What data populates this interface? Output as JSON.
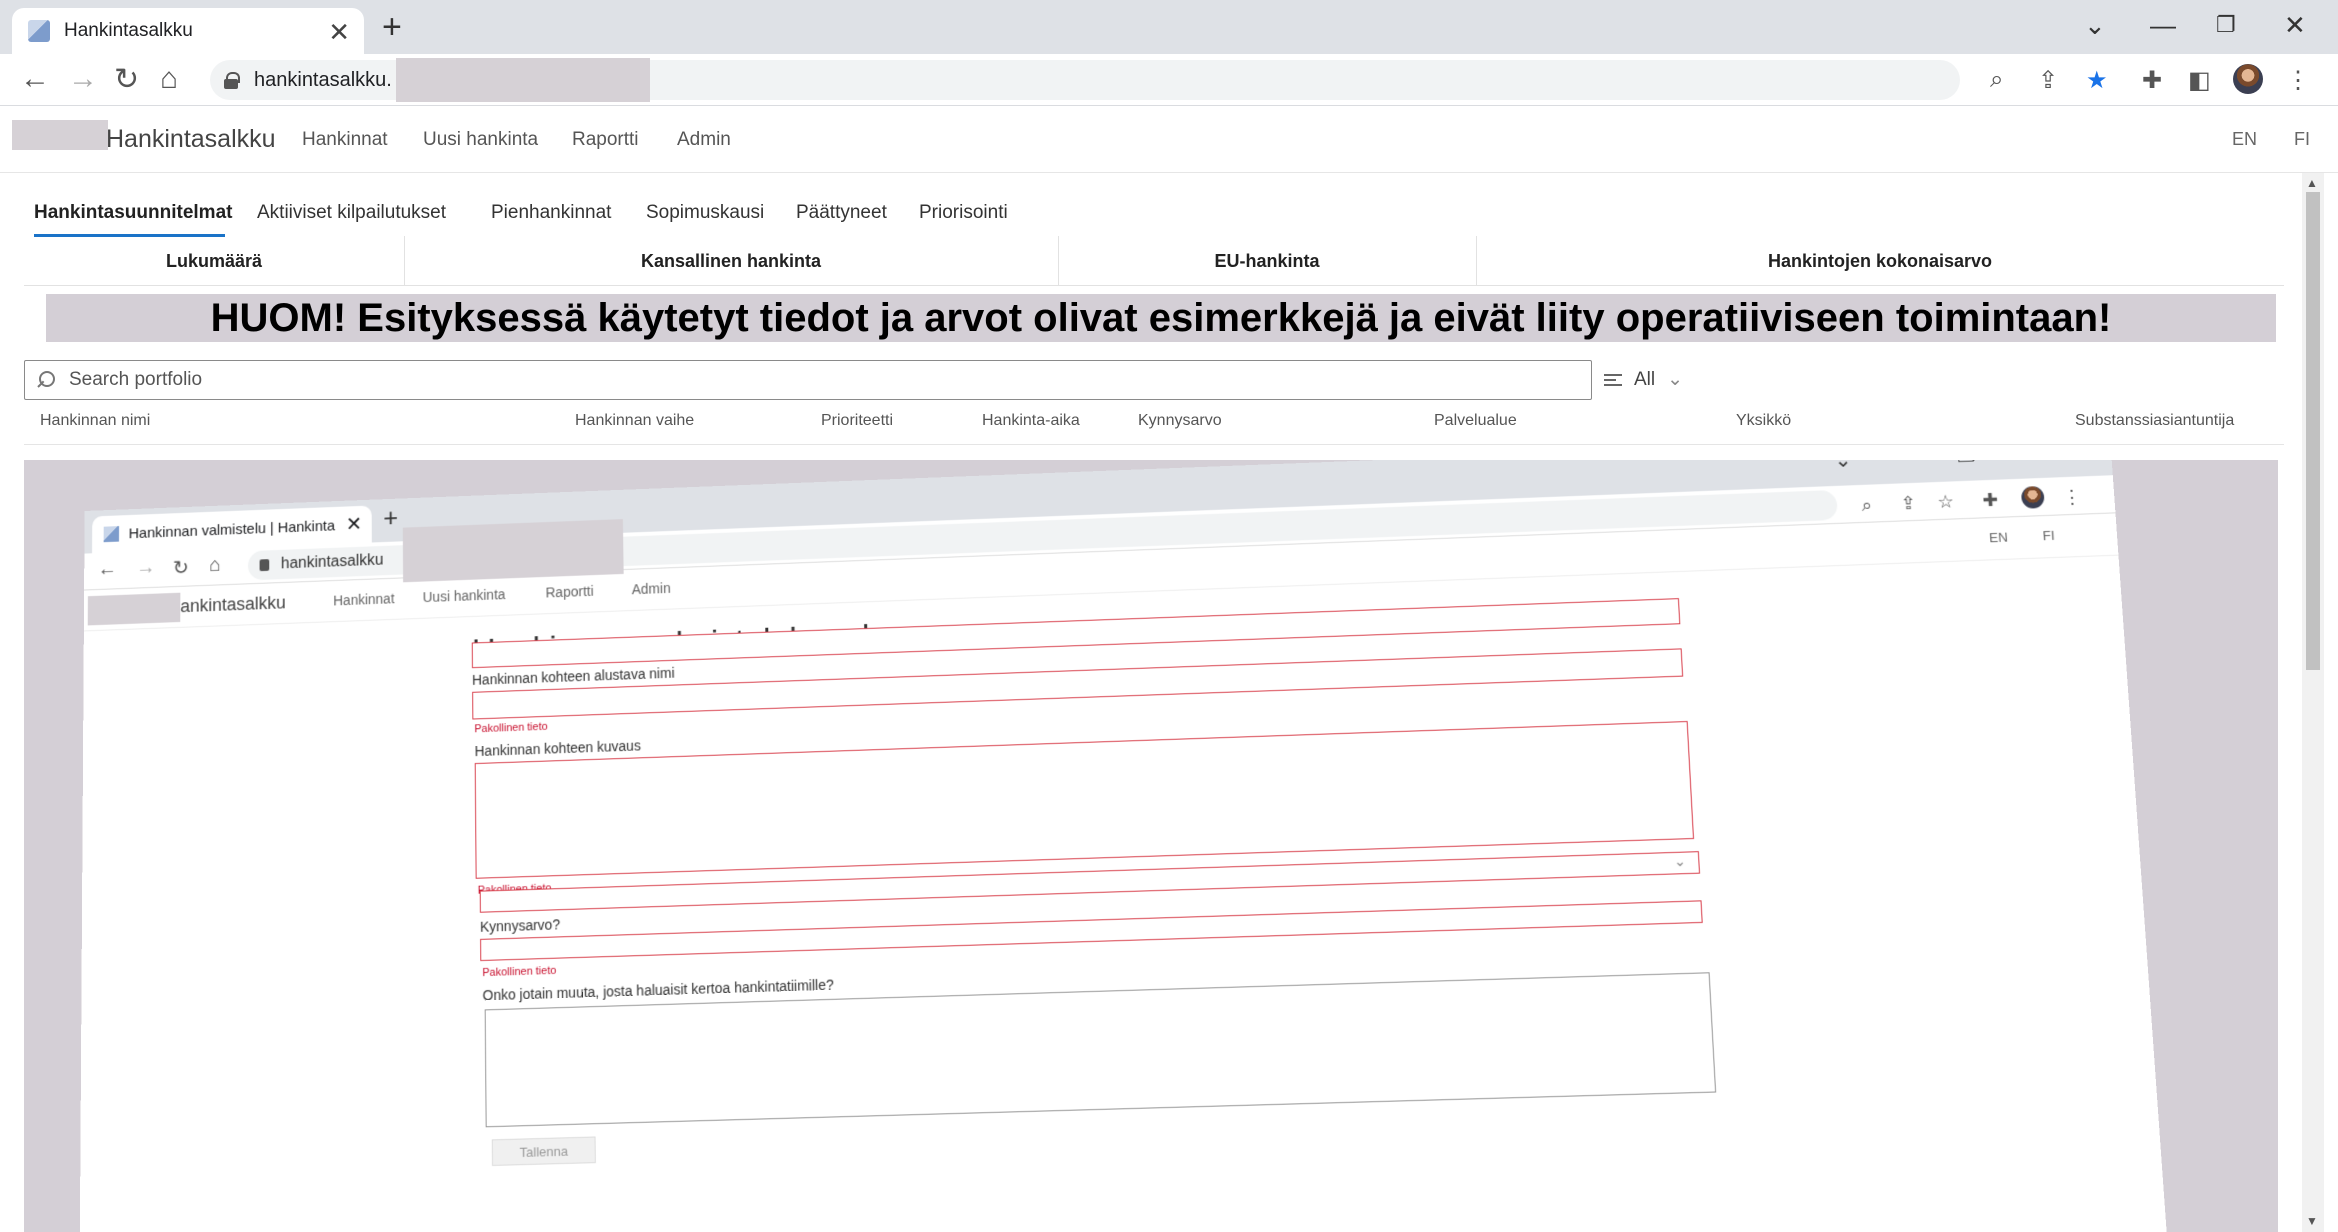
{
  "browser": {
    "tab_title": "Hankintasalkku",
    "tab_close": "✕",
    "new_tab": "+",
    "url_prefix": "hankintasalkku."
  },
  "app": {
    "brand": "Hankintasalkku",
    "nav": [
      "Hankinnat",
      "Uusi hankinta",
      "Raportti",
      "Admin"
    ],
    "lang": [
      "EN",
      "FI"
    ]
  },
  "portfolio_tabs": {
    "items": [
      "Hankintasuunnitelmat",
      "Aktiiviset kilpailutukset",
      "Pienhankinnat",
      "Sopimuskausi",
      "Päättyneet",
      "Priorisointi"
    ],
    "active": "Hankintasuunnitelmat"
  },
  "kpis": [
    "Lukumäärä",
    "Kansallinen hankinta",
    "EU-hankinta",
    "Hankintojen kokonaisarvo"
  ],
  "notice": "HUOM! Esityksessä käytetyt tiedot ja arvot olivat esimerkkejä ja eivät liity operatiiviseen toimintaan!",
  "search": {
    "placeholder": "Search portfolio",
    "filter_label": "All"
  },
  "columns": [
    "Hankinnan nimi",
    "Hankinnan vaihe",
    "Prioriteetti",
    "Hankinta-aika",
    "Kynnysarvo",
    "Palvelualue",
    "Yksikkö",
    "Substanssiasiantuntija"
  ],
  "inner": {
    "tab_title": "Hankinnan valmistelu | Hankinta",
    "tab_close": "✕",
    "new_tab": "+",
    "url_prefix": "hankintasalkku",
    "brand": "ankintasalkku",
    "nav": [
      "Hankinnat",
      "Uusi hankinta",
      "Raportti",
      "Admin"
    ],
    "lang": [
      "EN",
      "FI"
    ],
    "form": {
      "title": "Hankinnan valmistelulomake",
      "name_label": "Hankinnan kohteen alustava nimi",
      "required_1": "Pakollinen tieto",
      "desc_label": "Hankinnan kohteen kuvaus",
      "required_2": "Pakollinen tieto",
      "threshold_label": "Kynnysarvo?",
      "required_3": "Pakollinen tieto",
      "other_label": "Onko jotain muuta, josta haluaisit kertoa hankintatiimille?",
      "save_label": "Tallenna"
    }
  }
}
